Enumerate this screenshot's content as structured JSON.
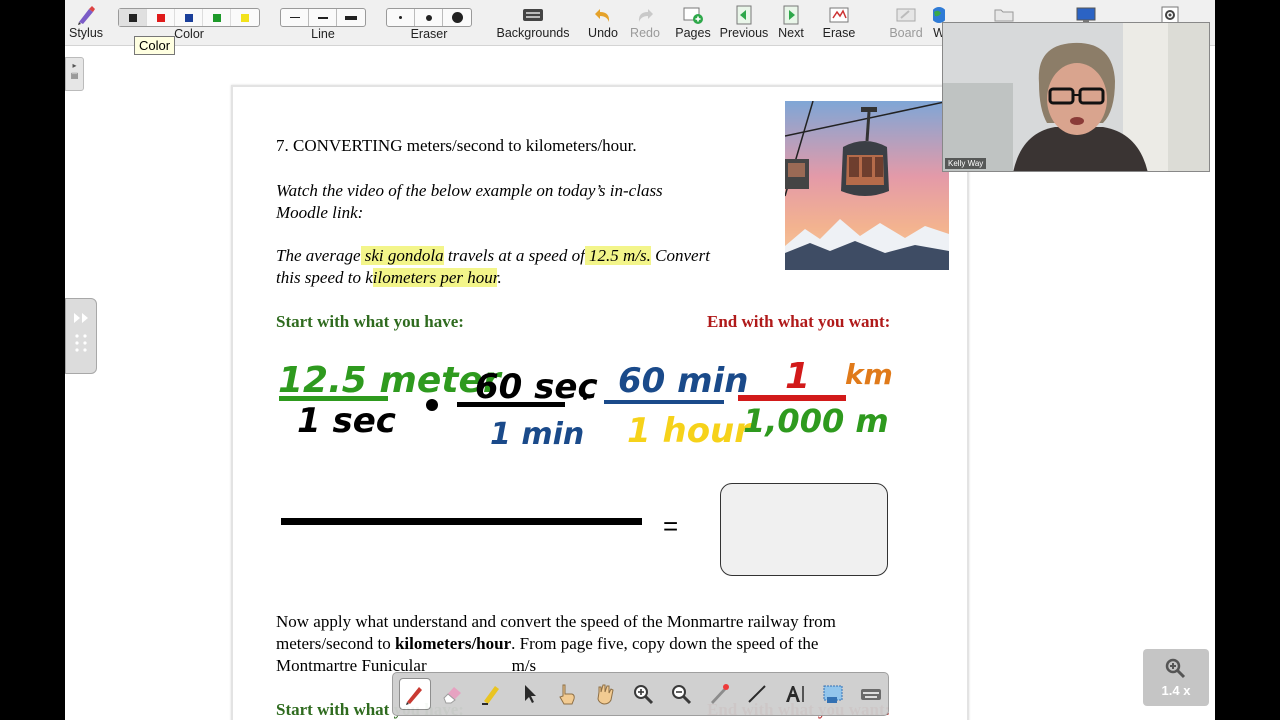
{
  "toolbar": {
    "stylus": "Stylus",
    "color": "Color",
    "line": "Line",
    "eraser": "Eraser",
    "backgrounds": "Backgrounds",
    "undo": "Undo",
    "redo": "Redo",
    "pages": "Pages",
    "previous": "Previous",
    "next": "Next",
    "erase": "Erase",
    "board": "Board",
    "cut_label": "W",
    "color_swatches": [
      "#222222",
      "#e01b1b",
      "#1a3f9a",
      "#1e9a2a",
      "#f2e21c"
    ]
  },
  "tooltip": "Color",
  "document": {
    "heading": "7. CONVERTING meters/second to kilometers/hour.",
    "instruction_line1": "Watch the video of the below example on today’s in-class",
    "instruction_line2": "Moodle link:",
    "problem_a": "The average",
    "problem_hl1": " ski gondola",
    "problem_b": " travels at a speed of",
    "problem_hl2": " 12.5 m/s.",
    "problem_c": " Convert",
    "problem2_a": "this speed to k",
    "problem2_hl": "ilometers per hour",
    "problem2_b": ".",
    "start_label": "Start with what you have:",
    "end_label": "End with what you want:",
    "equals": "=",
    "apply_line1": "Now apply what understand and convert the speed of the Monmartre railway from",
    "apply_line2a": "meters/second to ",
    "apply_line2b": "kilometers/hour",
    "apply_line2c": ".  From page five,  copy down the speed of the",
    "apply_line3": "Montmartre Funicular                    m/s",
    "start_label2": "Start with what you have:",
    "end_label2": "End with what you want:"
  },
  "handwriting": {
    "f1_num": "12.5 meter",
    "f1_den": "1 sec",
    "f2_num": "60 sec",
    "f2_den": "1 min",
    "f3_num": "60 min",
    "f3_den": "1 hour",
    "f4_num": "1",
    "f4_unit": "km",
    "f4_den": "1,000 m",
    "colors": {
      "green": "#2e9a1e",
      "black": "#000000",
      "blue": "#1a4a8a",
      "yellow": "#f6d21a",
      "red": "#d21a1a"
    }
  },
  "webcam": {
    "name": "Kelly Way"
  },
  "zoom": {
    "label": "1.4 x"
  }
}
